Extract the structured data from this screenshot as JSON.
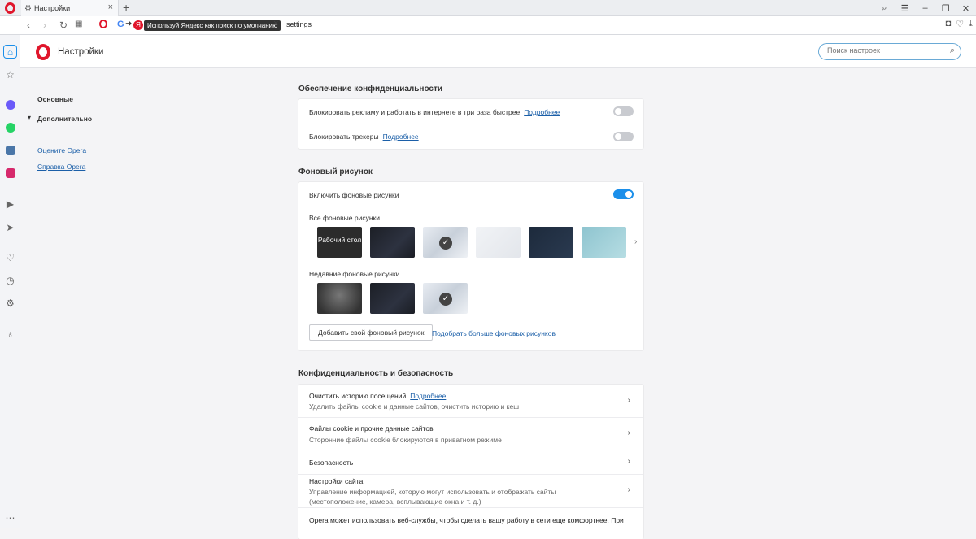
{
  "tab": {
    "title": "Настройки"
  },
  "address": {
    "banner": "Используй Яндекс как поиск по умолчанию",
    "url": "settings"
  },
  "header": {
    "title": "Настройки",
    "search_placeholder": "Поиск настроек"
  },
  "leftnav": {
    "basic": "Основные",
    "advanced": "Дополнительно",
    "rate": "Оцените Opera",
    "help": "Справка Opera"
  },
  "privacy_protection": {
    "title": "Обеспечение конфиденциальности",
    "rows": [
      {
        "label": "Блокировать рекламу и работать в интернете в три раза быстрее",
        "link": "Подробнее",
        "on": false
      },
      {
        "label": "Блокировать трекеры",
        "link": "Подробнее",
        "on": false
      }
    ]
  },
  "wallpaper": {
    "title": "Фоновый рисунок",
    "enable_label": "Включить фоновые рисунки",
    "enabled": true,
    "all_label": "Все фоновые рисунки",
    "desktop_label": "Рабочий стол",
    "recent_label": "Недавние фоновые рисунки",
    "add_button": "Добавить свой фоновый рисунок",
    "more_link": "Подобрать больше фоновых рисунков"
  },
  "security": {
    "title": "Конфиденциальность и безопасность",
    "rows": [
      {
        "title": "Очистить историю посещений",
        "link": "Подробнее",
        "desc": "Удалить файлы cookie и данные сайтов, очистить историю и кеш"
      },
      {
        "title": "Файлы cookie и прочие данные сайтов",
        "desc": "Сторонние файлы cookie блокируются в приватном режиме"
      },
      {
        "title": "Безопасность"
      },
      {
        "title": "Настройки сайта",
        "desc": "Управление информацией, которую могут использовать и отображать сайты (местоположение, камера, всплывающие окна и т. д.)"
      }
    ],
    "footer_text": "Opera может использовать веб-службы, чтобы сделать вашу работу в сети еще комфортнее. При"
  },
  "colors": {
    "accent": "#1b8fea",
    "opera_red": "#e0162b",
    "link": "#1b5fa8"
  }
}
